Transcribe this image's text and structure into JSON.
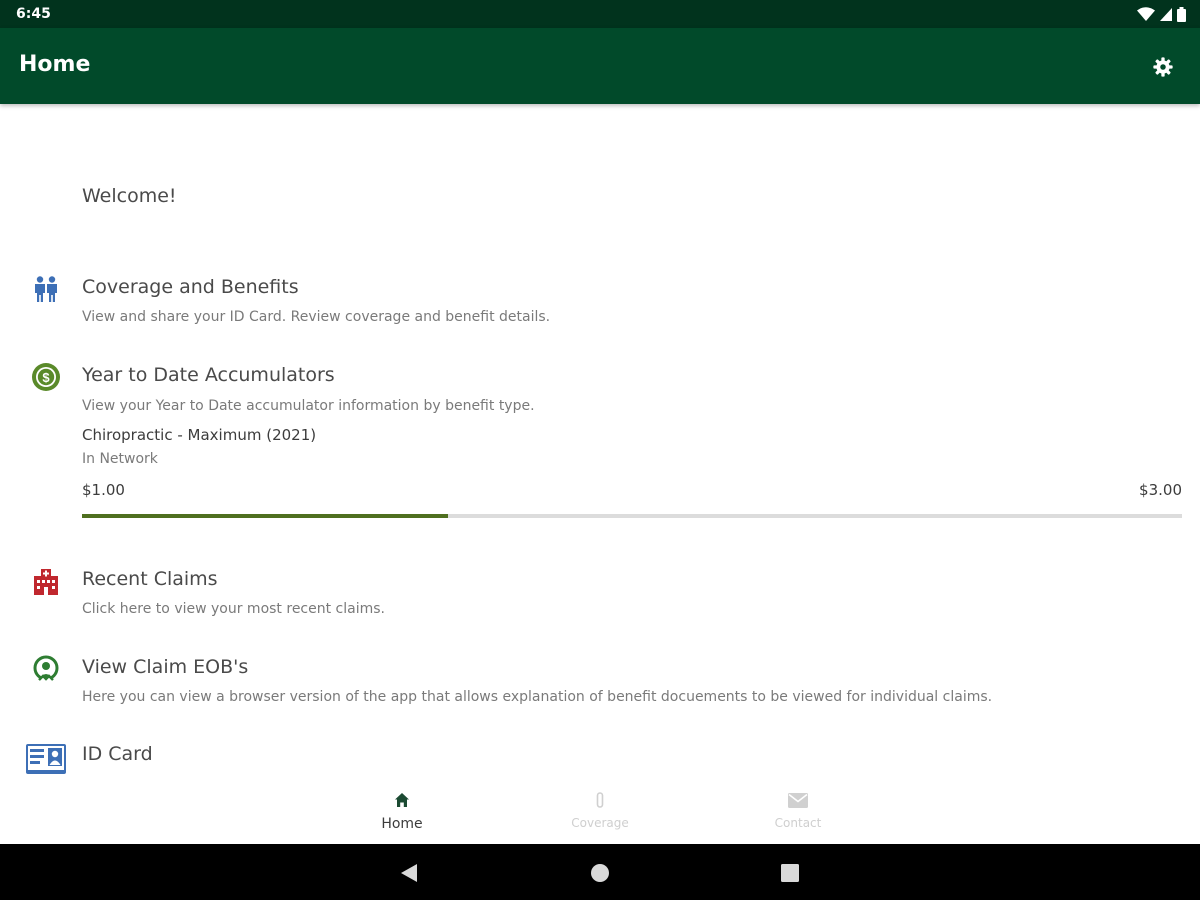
{
  "status_bar": {
    "time": "6:45",
    "icons": [
      "wifi-icon",
      "signal-icon",
      "battery-icon"
    ]
  },
  "app_bar": {
    "title": "Home",
    "settings_icon": "gear-icon"
  },
  "welcome": "Welcome!",
  "menu": [
    {
      "title": "Coverage and Benefits",
      "subtitle": "View and share your ID Card. Review coverage and benefit details.",
      "icon": "family-icon",
      "icon_color": "#3d6fb6"
    },
    {
      "title": "Year to Date Accumulators",
      "subtitle": "View your Year to Date accumulator information by benefit type.",
      "icon": "dollar-coin-icon",
      "icon_color": "#5a8a2a"
    },
    {
      "title": "Recent Claims",
      "subtitle": "Click here to view your most recent claims.",
      "icon": "hospital-icon",
      "icon_color": "#c0282e"
    },
    {
      "title": "View Claim EOB's",
      "subtitle": "Here you can view a browser version of the app that allows explanation of benefit docuements to be viewed for individual claims.",
      "icon": "eob-icon",
      "icon_color": "#2e7d32"
    },
    {
      "title": "ID Card",
      "icon": "id-card-icon",
      "icon_color": "#3d6fb6"
    }
  ],
  "accumulator": {
    "name": "Chiropractic - Maximum (2021)",
    "network": "In Network",
    "min_label": "$1.00",
    "max_label": "$3.00",
    "progress_fraction": 0.333
  },
  "bottom_nav": [
    {
      "label": "Home",
      "icon": "home-icon",
      "active": true
    },
    {
      "label": "Coverage",
      "icon": "coverage-icon",
      "active": false
    },
    {
      "label": "Contact",
      "icon": "envelope-icon",
      "active": false
    }
  ],
  "system_nav": [
    "back-icon",
    "home-circle-icon",
    "recents-square-icon"
  ],
  "colors": {
    "status_bar": "#01331d",
    "app_bar": "#014a2a",
    "progress": "#4f6f1f",
    "track": "#dcdcdc"
  }
}
